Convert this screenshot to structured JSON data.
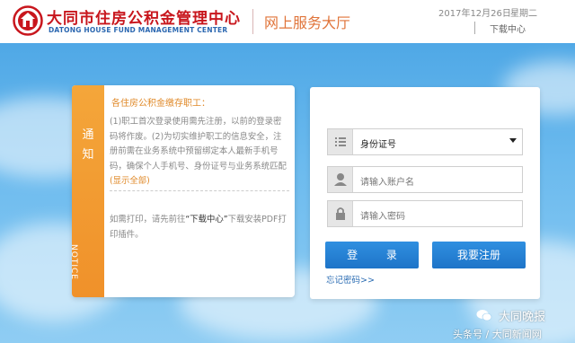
{
  "header": {
    "org_name_cn": "大同市住房公积金管理中心",
    "org_name_en": "DATONG HOUSE FUND MANAGEMENT CENTER",
    "service_hall": "网上服务大厅",
    "date": "2017年12月26日",
    "weekday": "星期二",
    "download_center": "下载中心"
  },
  "notice": {
    "strip_label_cn": "通知",
    "strip_label_en": "NOTICE",
    "title": "各住房公积金缴存职工：",
    "body": "(1)职工首次登录使用需先注册，以前的登录密码将作废。(2)为切实维护职工的信息安全，注册前需在业务系统中预留绑定本人最新手机号码，确保个人手机号、身份证号与业务系统匹配",
    "show_all": "(显示全部)",
    "print_pre": "如需打印，请先前往",
    "print_link": "“下载中心”",
    "print_post": "下载安装PDF打印插件。"
  },
  "login": {
    "id_type_selected": "身份证号",
    "account_placeholder": "请输入账户名",
    "password_placeholder": "请输入密码",
    "login_button": "登 录",
    "register_button": "我要注册",
    "forgot_password": "忘记密码>>"
  },
  "watermark": {
    "name": "大同晚报",
    "sub": "头条号 / 大同新闻网"
  },
  "colors": {
    "brand_red": "#c8161d",
    "accent_orange": "#f0912a",
    "button_blue": "#1e74c8",
    "sky_blue": "#6bbaee"
  }
}
